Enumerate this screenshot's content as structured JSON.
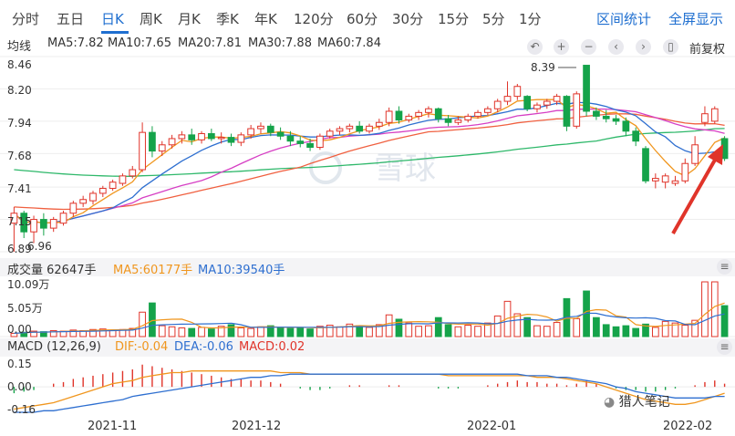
{
  "tabs": [
    "分时",
    "五日",
    "日K",
    "周K",
    "月K",
    "季K",
    "年K",
    "120分",
    "60分",
    "30分",
    "15分",
    "5分",
    "1分"
  ],
  "active_tab": "日K",
  "links": {
    "range_stats": "区间统计",
    "fullscreen": "全屏显示"
  },
  "ma_legend": {
    "title": "均线",
    "items": [
      {
        "label": "MA5:7.82",
        "color": "#f0961e"
      },
      {
        "label": "MA10:7.65",
        "color": "#2e6fd0"
      },
      {
        "label": "MA20:7.81",
        "color": "#d63fc4"
      },
      {
        "label": "MA30:7.88",
        "color": "#f06040"
      },
      {
        "label": "MA60:7.84",
        "color": "#2eb86a"
      }
    ]
  },
  "controls": {
    "zoom_in": "+",
    "zoom_out": "−",
    "prev": "‹",
    "next": "›",
    "fq": "前复权"
  },
  "price_axis": [
    "8.46",
    "8.20",
    "7.94",
    "7.68",
    "7.41",
    "7.15",
    "6.89"
  ],
  "annotations": {
    "high": "8.39",
    "low": "6.96"
  },
  "watermark": "雪球",
  "volume_legend": {
    "title": "成交量 62647手",
    "ma5": "MA5:60177手",
    "ma10": "MA10:39540手"
  },
  "volume_axis": [
    "10.09万",
    "5.05万",
    "0.00"
  ],
  "macd_legend": {
    "title": "MACD (12,26,9)",
    "dif": "DIF:-0.04",
    "dea": "DEA:-0.06",
    "macd": "MACD:0.02"
  },
  "macd_axis": [
    "0.15",
    "0.00",
    "-0.16"
  ],
  "date_axis": [
    "2021-11",
    "2021-12",
    "2022-01",
    "2022-02"
  ],
  "credit": "猎人笔记",
  "colors": {
    "up": "#e0342a",
    "down": "#15a34a",
    "accent": "#1f6fd0",
    "ma5": "#f0961e",
    "ma10": "#2e6fd0",
    "ma20": "#d63fc4",
    "ma30": "#f06040",
    "ma60": "#2eb86a",
    "dif": "#f0961e",
    "dea": "#2e6fd0"
  },
  "chart_data": {
    "type": "candlestick",
    "candles": [
      [
        7.12,
        7.25,
        7.2,
        6.89
      ],
      [
        7.2,
        7.22,
        7.05,
        7.0
      ],
      [
        7.05,
        7.18,
        7.15,
        6.96
      ],
      [
        7.15,
        7.2,
        7.08,
        7.02
      ],
      [
        7.08,
        7.17,
        7.15,
        7.05
      ],
      [
        7.12,
        7.22,
        7.2,
        7.1
      ],
      [
        7.2,
        7.3,
        7.28,
        7.17
      ],
      [
        7.28,
        7.34,
        7.31,
        7.25
      ],
      [
        7.3,
        7.38,
        7.36,
        7.27
      ],
      [
        7.36,
        7.42,
        7.4,
        7.33
      ],
      [
        7.4,
        7.47,
        7.45,
        7.38
      ],
      [
        7.44,
        7.52,
        7.5,
        7.42
      ],
      [
        7.5,
        7.58,
        7.55,
        7.48
      ],
      [
        7.55,
        7.93,
        7.85,
        7.53
      ],
      [
        7.85,
        7.9,
        7.7,
        7.65
      ],
      [
        7.7,
        7.78,
        7.75,
        7.66
      ],
      [
        7.75,
        7.83,
        7.8,
        7.72
      ],
      [
        7.8,
        7.86,
        7.83,
        7.76
      ],
      [
        7.83,
        7.88,
        7.79,
        7.75
      ],
      [
        7.79,
        7.86,
        7.84,
        7.76
      ],
      [
        7.84,
        7.88,
        7.8,
        7.78
      ],
      [
        7.8,
        7.85,
        7.81,
        7.76
      ],
      [
        7.81,
        7.84,
        7.77,
        7.74
      ],
      [
        7.77,
        7.85,
        7.83,
        7.74
      ],
      [
        7.83,
        7.91,
        7.88,
        7.8
      ],
      [
        7.88,
        7.93,
        7.9,
        7.84
      ],
      [
        7.9,
        7.92,
        7.85,
        7.82
      ],
      [
        7.85,
        7.89,
        7.82,
        7.79
      ],
      [
        7.82,
        7.86,
        7.78,
        7.74
      ],
      [
        7.78,
        7.82,
        7.76,
        7.73
      ],
      [
        7.76,
        7.8,
        7.73,
        7.7
      ],
      [
        7.73,
        7.84,
        7.82,
        7.71
      ],
      [
        7.82,
        7.88,
        7.86,
        7.8
      ],
      [
        7.86,
        7.9,
        7.88,
        7.83
      ],
      [
        7.88,
        7.92,
        7.9,
        7.85
      ],
      [
        7.9,
        7.94,
        7.86,
        7.84
      ],
      [
        7.86,
        7.92,
        7.9,
        7.84
      ],
      [
        7.9,
        7.96,
        7.93,
        7.87
      ],
      [
        7.93,
        8.05,
        8.02,
        7.9
      ],
      [
        8.02,
        8.06,
        7.95,
        7.92
      ],
      [
        7.95,
        8.0,
        7.98,
        7.93
      ],
      [
        7.98,
        8.03,
        8.01,
        7.95
      ],
      [
        8.01,
        8.06,
        8.04,
        7.97
      ],
      [
        8.04,
        8.05,
        7.96,
        7.93
      ],
      [
        7.96,
        7.99,
        7.93,
        7.9
      ],
      [
        7.93,
        7.98,
        7.95,
        7.91
      ],
      [
        7.95,
        8.0,
        7.98,
        7.93
      ],
      [
        7.98,
        8.03,
        8.01,
        7.96
      ],
      [
        8.01,
        8.06,
        8.04,
        7.99
      ],
      [
        8.04,
        8.12,
        8.1,
        8.01
      ],
      [
        8.1,
        8.26,
        8.14,
        8.07
      ],
      [
        8.14,
        8.24,
        8.22,
        8.11
      ],
      [
        8.14,
        8.15,
        8.04,
        8.02
      ],
      [
        8.04,
        8.09,
        8.07,
        8.01
      ],
      [
        8.07,
        8.12,
        8.1,
        8.04
      ],
      [
        8.1,
        8.16,
        8.14,
        8.07
      ],
      [
        8.14,
        8.15,
        7.9,
        7.86
      ],
      [
        7.9,
        8.18,
        8.16,
        7.88
      ],
      [
        8.39,
        8.39,
        8.02,
        7.98
      ],
      [
        8.02,
        8.05,
        7.98,
        7.95
      ],
      [
        7.98,
        8.03,
        7.96,
        7.93
      ],
      [
        7.96,
        7.99,
        7.94,
        7.91
      ],
      [
        7.94,
        7.97,
        7.86,
        7.82
      ],
      [
        7.86,
        7.89,
        7.78,
        7.74
      ],
      [
        7.72,
        7.74,
        7.46,
        7.44
      ],
      [
        7.46,
        7.52,
        7.48,
        7.4
      ],
      [
        7.45,
        7.52,
        7.5,
        7.4
      ],
      [
        7.44,
        7.5,
        7.46,
        7.42
      ],
      [
        7.46,
        7.64,
        7.6,
        7.44
      ],
      [
        7.6,
        7.82,
        7.75,
        7.58
      ],
      [
        7.93,
        8.06,
        8.0,
        7.9
      ],
      [
        7.94,
        8.06,
        8.04,
        7.92
      ],
      [
        7.8,
        7.82,
        7.64,
        7.62
      ]
    ],
    "volume_max": 10.09,
    "volumes": [
      0.6,
      0.8,
      1.0,
      0.9,
      1.1,
      1.0,
      1.2,
      1.1,
      1.3,
      1.4,
      1.2,
      1.3,
      1.5,
      4.5,
      6.2,
      2.0,
      1.8,
      1.6,
      1.5,
      1.7,
      1.4,
      1.9,
      2.2,
      1.6,
      1.5,
      1.8,
      2.0,
      1.7,
      1.5,
      1.6,
      1.4,
      1.9,
      2.1,
      1.8,
      2.3,
      2.0,
      1.7,
      2.2,
      4.0,
      3.2,
      2.5,
      1.9,
      2.0,
      3.5,
      2.2,
      1.8,
      2.1,
      1.9,
      2.5,
      3.8,
      6.5,
      4.2,
      3.5,
      2.0,
      1.9,
      2.6,
      7.0,
      3.3,
      8.4,
      3.5,
      2.2,
      1.8,
      2.0,
      1.5,
      2.3,
      1.7,
      2.8,
      2.5,
      2.1,
      3.0,
      10.09,
      10.09,
      5.7
    ],
    "macd_hist": [
      -0.04,
      -0.03,
      -0.02,
      0.0,
      0.02,
      0.03,
      0.05,
      0.06,
      0.07,
      0.08,
      0.09,
      0.1,
      0.11,
      0.14,
      0.13,
      0.12,
      0.11,
      0.1,
      0.09,
      0.08,
      0.07,
      0.06,
      0.05,
      0.05,
      0.04,
      0.04,
      0.03,
      0.02,
      0.0,
      -0.01,
      -0.02,
      -0.02,
      -0.01,
      0.0,
      0.01,
      0.01,
      0.0,
      0.0,
      0.01,
      0.01,
      0.0,
      0.0,
      0.0,
      -0.01,
      -0.01,
      -0.01,
      0.0,
      0.0,
      0.01,
      0.02,
      0.03,
      0.04,
      0.03,
      0.03,
      0.02,
      0.02,
      0.01,
      0.02,
      0.04,
      0.02,
      0.0,
      -0.01,
      -0.02,
      -0.02,
      -0.03,
      -0.03,
      -0.02,
      -0.01,
      0.0,
      0.01,
      0.03,
      0.04,
      0.02
    ],
    "dif": [
      -0.14,
      -0.13,
      -0.12,
      -0.11,
      -0.1,
      -0.08,
      -0.06,
      -0.04,
      -0.02,
      0.0,
      0.02,
      0.03,
      0.04,
      0.06,
      0.07,
      0.08,
      0.09,
      0.09,
      0.1,
      0.1,
      0.1,
      0.1,
      0.1,
      0.1,
      0.1,
      0.1,
      0.1,
      0.09,
      0.09,
      0.09,
      0.08,
      0.08,
      0.08,
      0.08,
      0.08,
      0.08,
      0.08,
      0.08,
      0.08,
      0.08,
      0.08,
      0.08,
      0.08,
      0.08,
      0.07,
      0.07,
      0.07,
      0.07,
      0.07,
      0.07,
      0.07,
      0.07,
      0.07,
      0.06,
      0.06,
      0.06,
      0.05,
      0.04,
      0.03,
      0.02,
      0.0,
      -0.02,
      -0.04,
      -0.06,
      -0.08,
      -0.09,
      -0.1,
      -0.11,
      -0.11,
      -0.1,
      -0.08,
      -0.06,
      -0.04
    ],
    "dea": [
      -0.16,
      -0.16,
      -0.16,
      -0.15,
      -0.15,
      -0.14,
      -0.13,
      -0.12,
      -0.11,
      -0.1,
      -0.09,
      -0.08,
      -0.06,
      -0.05,
      -0.04,
      -0.03,
      -0.02,
      -0.01,
      0.0,
      0.01,
      0.02,
      0.03,
      0.04,
      0.05,
      0.06,
      0.06,
      0.07,
      0.07,
      0.08,
      0.08,
      0.08,
      0.08,
      0.08,
      0.08,
      0.08,
      0.08,
      0.08,
      0.08,
      0.08,
      0.08,
      0.08,
      0.08,
      0.08,
      0.08,
      0.08,
      0.08,
      0.08,
      0.08,
      0.08,
      0.08,
      0.08,
      0.08,
      0.07,
      0.07,
      0.07,
      0.06,
      0.06,
      0.05,
      0.04,
      0.03,
      0.02,
      0.0,
      -0.01,
      -0.03,
      -0.04,
      -0.05,
      -0.06,
      -0.07,
      -0.07,
      -0.07,
      -0.07,
      -0.06,
      -0.06
    ]
  }
}
